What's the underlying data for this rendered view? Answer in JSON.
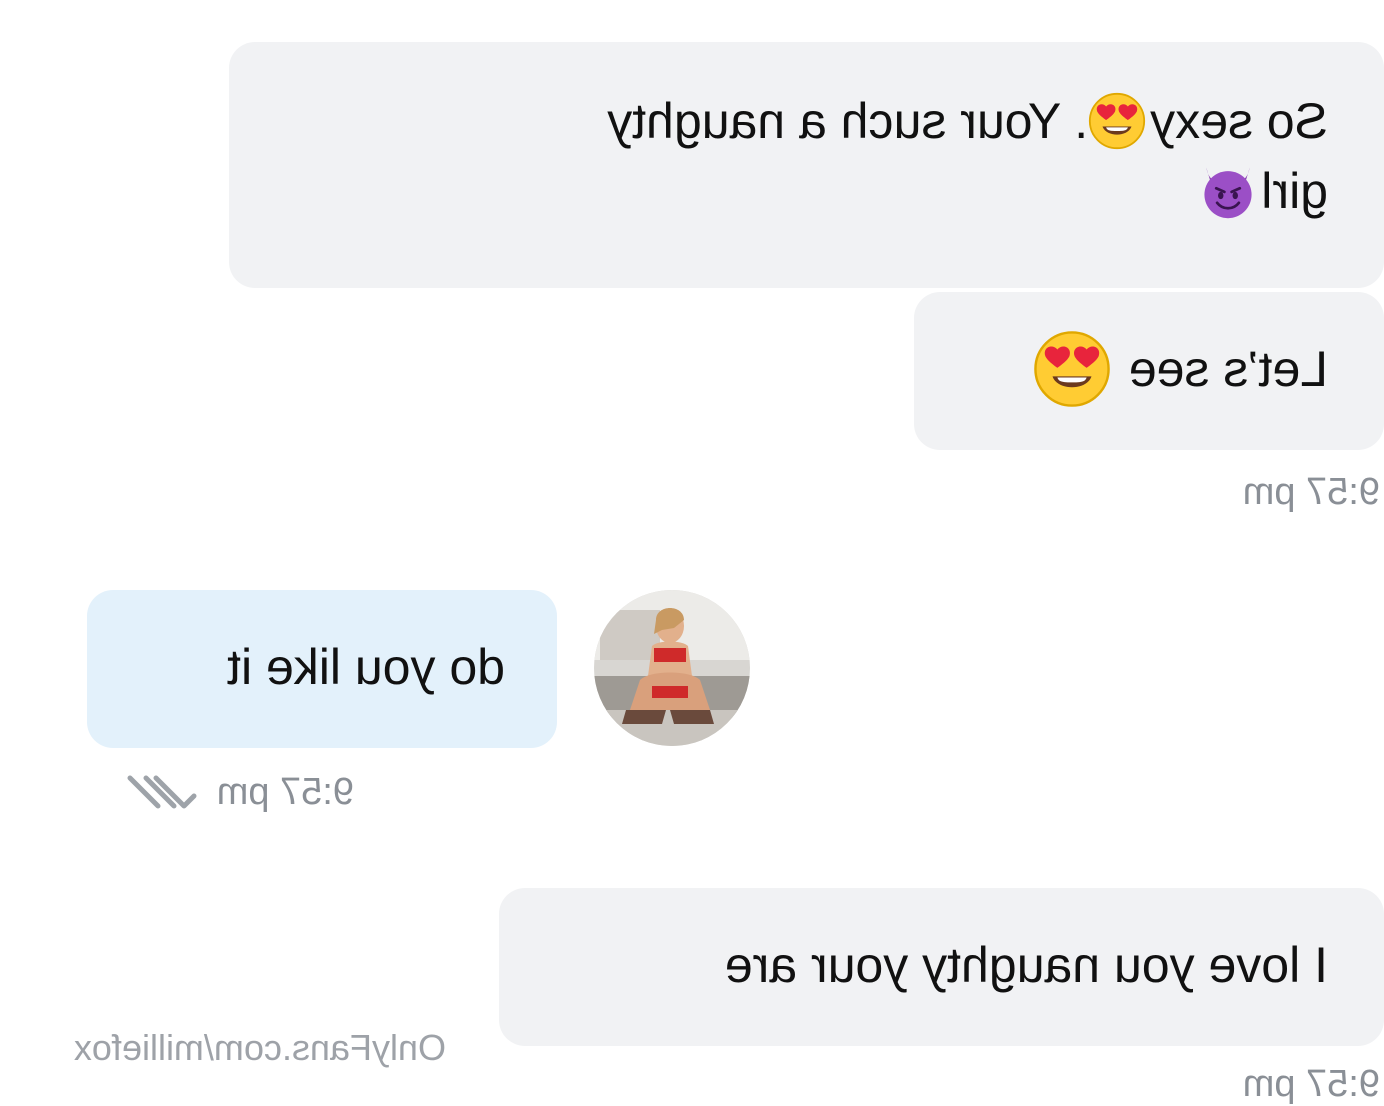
{
  "watermark": "OnlyFans.com/milliefox",
  "messages": [
    {
      "sender": "me",
      "text_part1": "So sexy",
      "emoji1": "heart-eyes-emoji",
      "text_part2": ". Your such a naughty",
      "text_line2": "girl",
      "emoji2": "smiling-devil-emoji"
    },
    {
      "sender": "me",
      "text": "Let’s see",
      "emoji": "heart-eyes-emoji",
      "time": "9:57 pm"
    },
    {
      "sender": "them",
      "text": "do you like it",
      "time": "9:57 pm",
      "status_icon": "double-check-icon"
    },
    {
      "sender": "me",
      "text": "I love you naughty your are",
      "time": "9:57 pm"
    }
  ],
  "colors": {
    "sent_bubble": "#f1f2f4",
    "received_bubble": "#e3f1fb",
    "timestamp": "#8a8f96"
  }
}
